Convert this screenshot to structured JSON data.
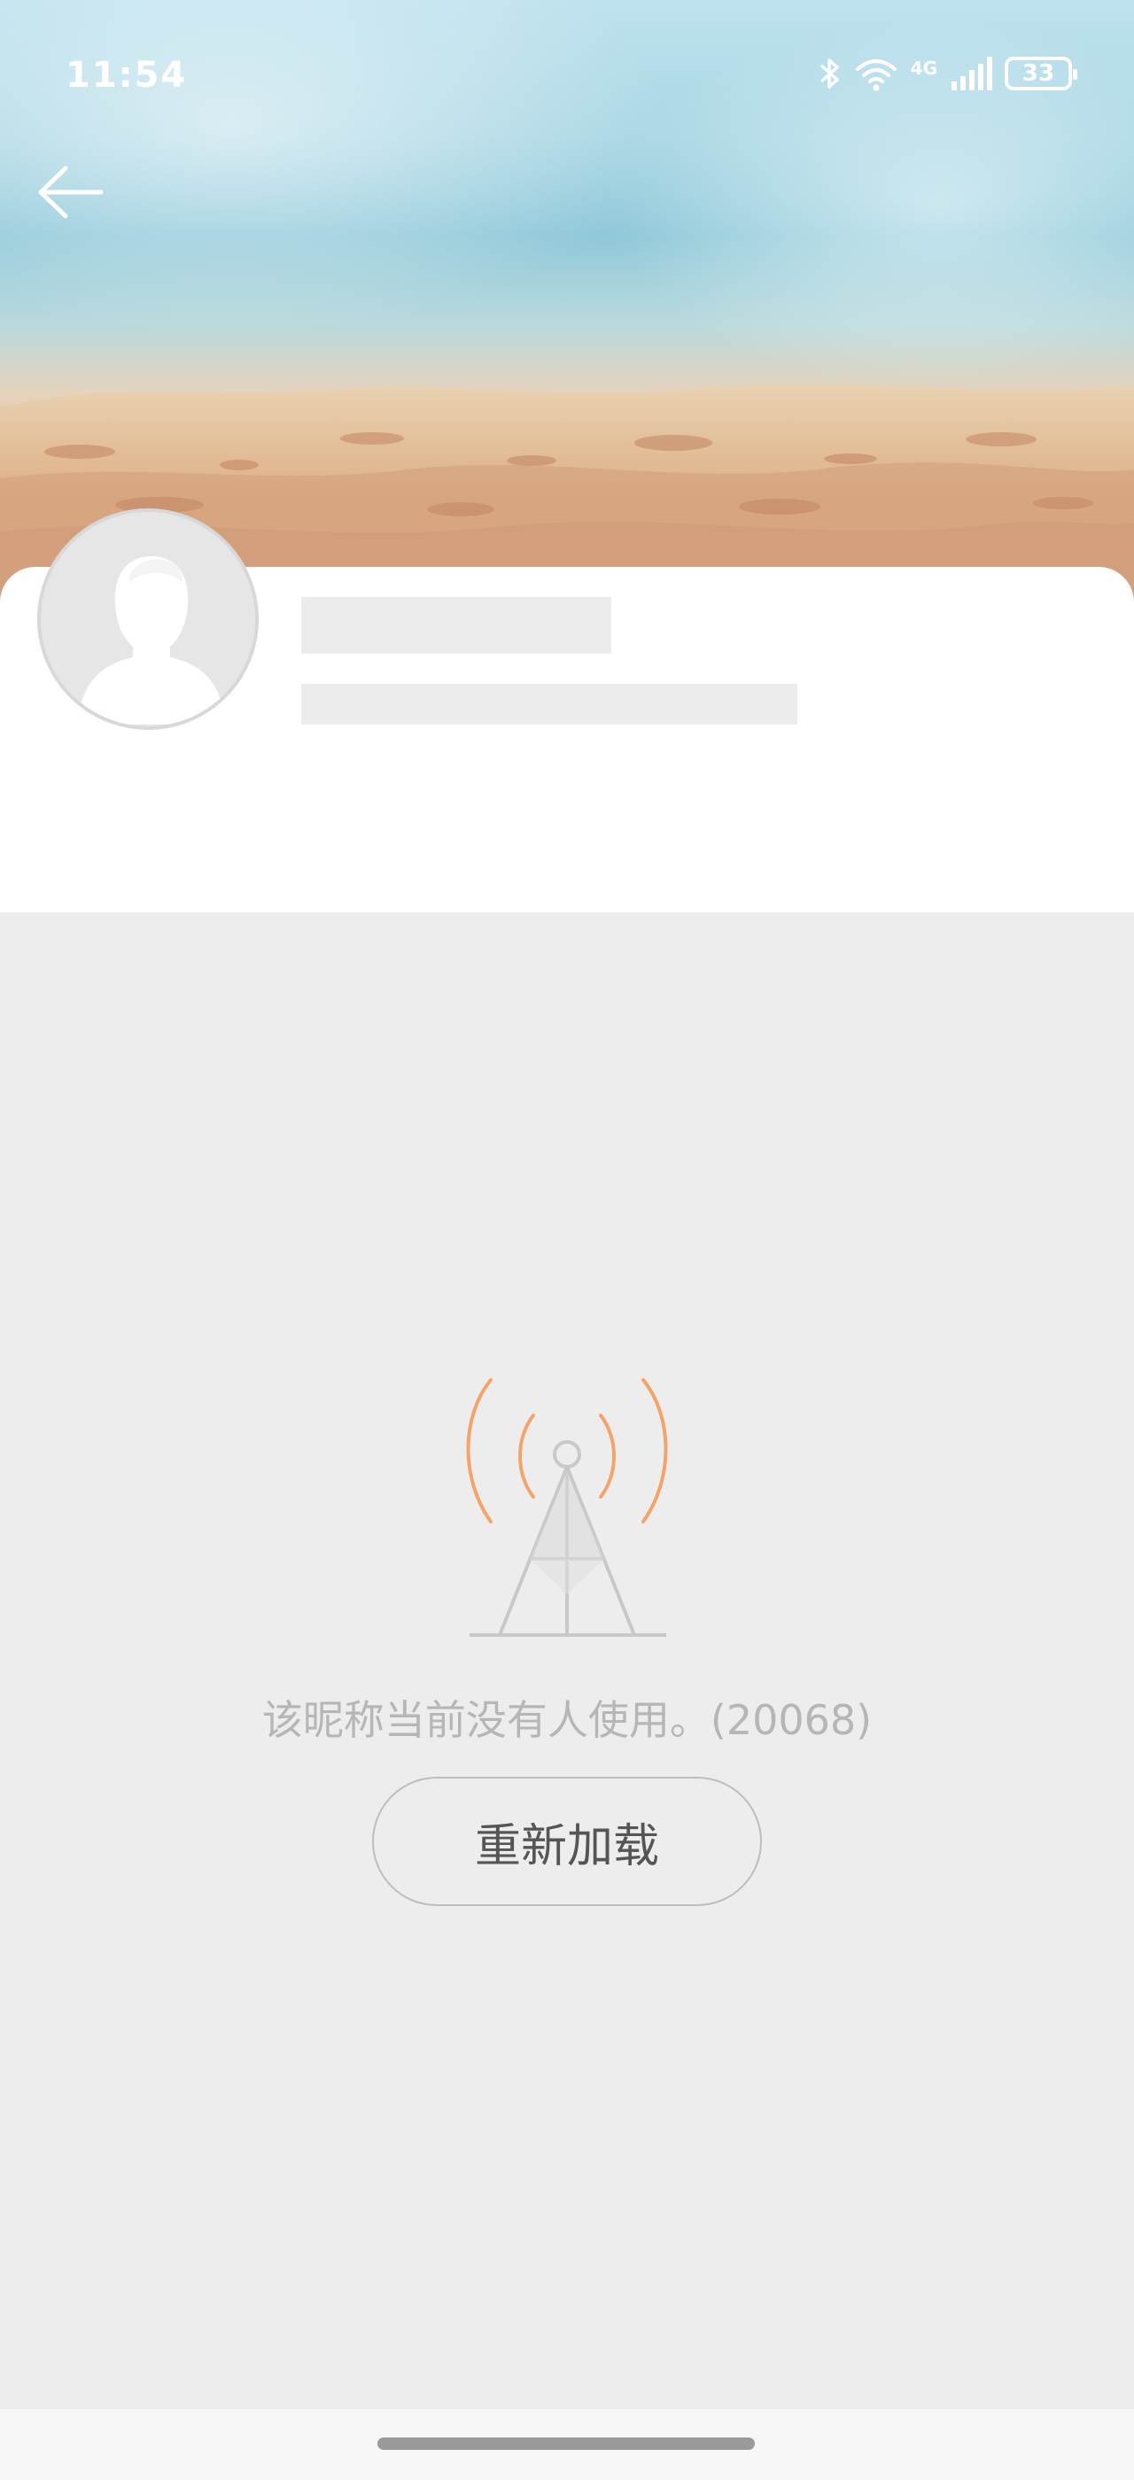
{
  "status_bar": {
    "time": "11:54",
    "network_label": "4G",
    "battery_level": "33",
    "icons": [
      "bluetooth-icon",
      "wifi-icon",
      "signal-icon",
      "battery-icon"
    ]
  },
  "header": {
    "back_icon": "arrow-left-icon",
    "banner_image": "beach-sand-photo"
  },
  "profile": {
    "avatar_icon": "default-person-avatar",
    "name_placeholder_state": "loading",
    "bio_placeholder_state": "loading"
  },
  "error_state": {
    "icon": "signal-tower-icon",
    "message": "该昵称当前没有人使用。(20068)",
    "reload_label": "重新加载"
  },
  "colors": {
    "accent_orange": "#f4a46a",
    "background": "#ededed",
    "card": "#ffffff",
    "muted_text": "#b6b6b6"
  }
}
